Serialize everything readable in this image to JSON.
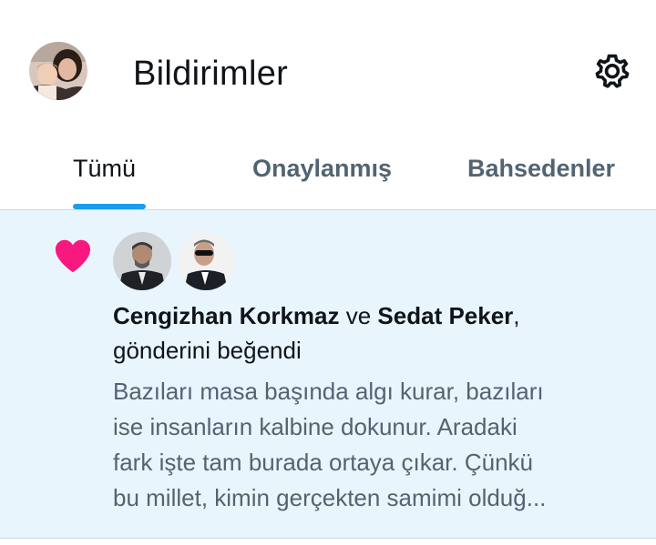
{
  "header": {
    "title": "Bildirimler",
    "avatar_icon": "profile-avatar",
    "settings_icon": "gear-icon"
  },
  "tabs": [
    {
      "label": "Tümü",
      "active": true
    },
    {
      "label": "Onaylanmış",
      "active": false
    },
    {
      "label": "Bahsedenler",
      "active": false
    }
  ],
  "colors": {
    "accent": "#1d9bf0",
    "heart": "#f91880",
    "notification_bg": "#e8f5fd",
    "secondary_text": "#536471"
  },
  "notification": {
    "type_icon": "heart-icon",
    "user1": "Cengizhan Korkmaz",
    "connector": " ve ",
    "user2": "Sedat Peker",
    "comma": ",",
    "action": "gönderini beğendi",
    "preview_lines": [
      "Bazıları masa başında algı kurar, bazıları",
      "ise insanların kalbine dokunur. Aradaki",
      "fark işte tam burada ortaya çıkar. Çünkü",
      "bu millet, kimin gerçekten samimi olduğ..."
    ]
  }
}
